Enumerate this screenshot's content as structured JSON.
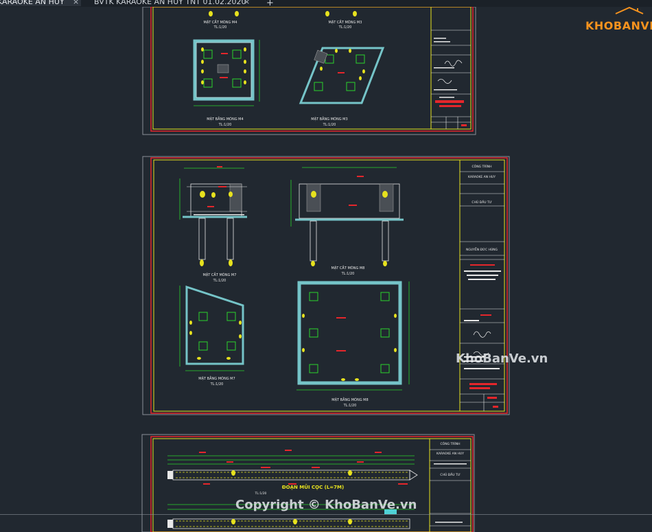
{
  "tabs": [
    {
      "label": "KARAOKE AN HUY",
      "active": true,
      "close_glyph": "×"
    },
    {
      "label": "BVTK KARAOKE AN HUY TNT 01.02.2020",
      "active": false,
      "close_glyph": "×"
    }
  ],
  "new_tab_glyph": "+",
  "logo": {
    "text": "KHOBANVE",
    "color": "#f7931e"
  },
  "watermarks": {
    "middle": "KhoBanVe.vn",
    "bottom": "Copyright © KhoBanVe.vn"
  },
  "sheet1": {
    "section_top_left": "MẶT CẮT MÓNG M4",
    "section_top_right": "MẶT CẮT MÓNG M3",
    "plan_left": "MẶT BẰNG MÓNG M4",
    "plan_right": "MẶT BẰNG MÓNG M3",
    "scale_a": "TL:1/20",
    "scale_b": "TL:1/20",
    "scale_c": "TL:1/20",
    "scale_d": "TL:1/20"
  },
  "sheet2": {
    "section_left": "MẶT CẮT MÓNG M7",
    "section_right": "MẶT CẮT MÓNG M8",
    "plan_left": "MẶT BẰNG MÓNG M7",
    "plan_right": "MẶT BẰNG MÓNG M8",
    "scale_a": "TL:1/20",
    "scale_b": "TL:1/20",
    "scale_c": "TL:1/20",
    "scale_d": "TL:1/20",
    "title_block": {
      "project_label": "CÔNG TRÌNH",
      "project_name": "KARAOKE AN HUY",
      "owner_label": "CHỦ ĐẦU TƯ",
      "owner_name": "NGUYỄN ĐỨC HÙNG"
    }
  },
  "sheet3": {
    "title": "ĐOẠN MŨI CỌC (L=7M)",
    "scale": "TL:1/20",
    "title_block": {
      "project_label": "CÔNG TRÌNH",
      "project_name": "KARAOKE AN HUY",
      "owner_label": "CHỦ ĐẦU TƯ"
    }
  }
}
